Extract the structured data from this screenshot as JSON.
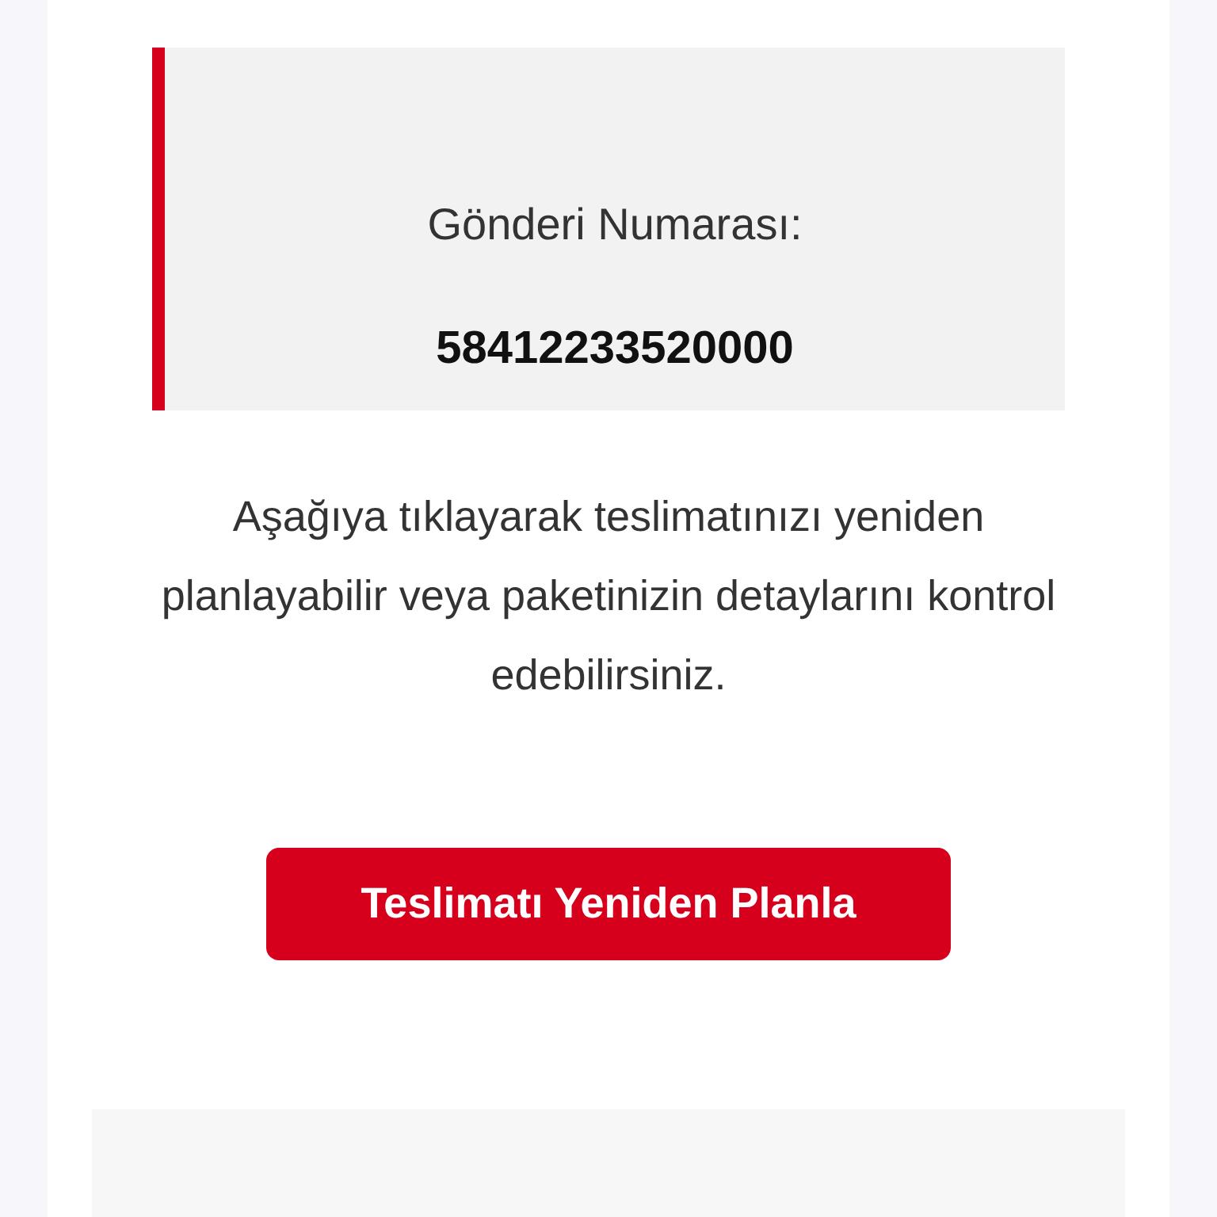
{
  "shipment": {
    "label": "Gönderi Numarası:",
    "number": "58412233520000"
  },
  "message": "Aşağıya tıklayarak teslimatınızı yeniden planlayabilir veya paketinizin detaylarını kontrol edebilirsiniz.",
  "button": {
    "label": "Teslimatı Yeniden Planla"
  }
}
